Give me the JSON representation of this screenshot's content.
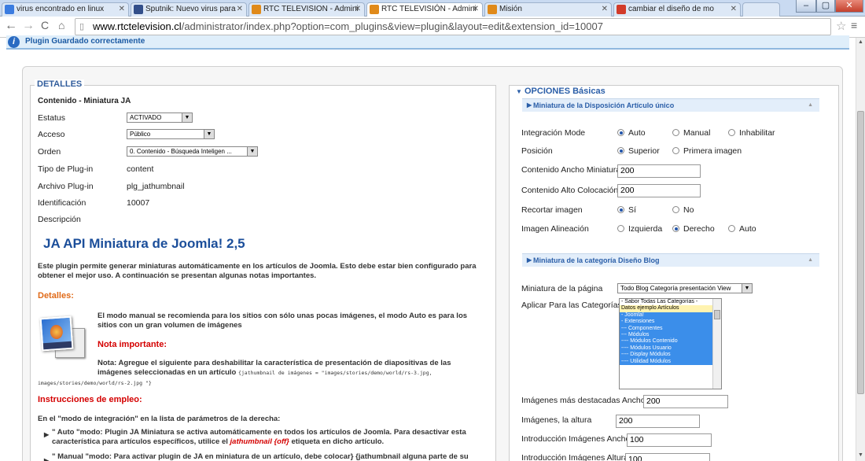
{
  "browser": {
    "tabs": [
      {
        "label": "virus encontrado en linux",
        "icon_color": "#3b7ce0"
      },
      {
        "label": "Sputnik: Nuevo virus para",
        "icon_color": "#334f8a"
      },
      {
        "label": "RTC TELEVISION - Admini",
        "icon_color": "#e08a1a"
      },
      {
        "label": "RTC TELEVISIÓN - Admini",
        "icon_color": "#e08a1a"
      },
      {
        "label": "Misión",
        "icon_color": "#e08a1a"
      },
      {
        "label": "cambiar el diseño de mo",
        "icon_color": "#d23b2a"
      }
    ],
    "url_host": "www.rtctelevision.cl",
    "url_path": "/administrator/index.php?option=com_plugins&view=plugin&layout=edit&extension_id=10007"
  },
  "message": "Plugin Guardado correctamente",
  "details": {
    "legend": "DETALLES",
    "plugin_title": "Contenido - Miniatura JA",
    "fields": {
      "estatus_label": "Estatus",
      "estatus_value": "ACTIVADO",
      "acceso_label": "Acceso",
      "acceso_value": "Público",
      "orden_label": "Orden",
      "orden_value": "0. Contenido - Búsqueda Inteligen ...",
      "tipo_label": "Tipo de Plug-in",
      "tipo_value": "content",
      "archivo_label": "Archivo Plug-in",
      "archivo_value": "plg_jathumbnail",
      "id_label": "Identificación",
      "id_value": "10007",
      "desc_label": "Descripción"
    },
    "description": {
      "title": "JA API Miniatura de Joomla! 2,5",
      "intro_1": "Este plugin permite generar miniaturas automáticamente en los artículos de Joomla. Esto debe estar bien configurado para",
      "intro_2": "obtener el mejor uso. A continuación se presentan algunas notas importantes.",
      "detalles_heading": "Detalles:",
      "detalles_1": "El modo manual se recomienda para los sitios con sólo unas pocas imágenes, el modo Auto es para los",
      "detalles_2": "sitios con un gran volumen de imágenes",
      "nota_heading": "Nota importante:",
      "nota_1": "Nota: Agregue el siguiente para deshabilitar la característica de presentación de diapositivas de las",
      "nota_2": "imágenes seleccionadas en un artículo",
      "nota_code_1": "{jathumbnail de imágenes = \"images/stories/demo/world/rs-3.jpg,",
      "nota_code_2": "images/stories/demo/world/rs-2.jpg \"}",
      "instr_heading": "Instrucciones de empleo:",
      "instr_intro": "En el \"modo de integración\" en la lista de parámetros de la derecha:",
      "bullet1_1": "\" Auto \"modo: Plugin JA Miniatura se activa automáticamente en todos los artículos de Joomla. Para desactivar esta",
      "bullet1_2": "característica para artículos específicos, utilice el",
      "bullet1_code": "jathumbnail {off}",
      "bullet1_3": "etiqueta en dicho artículo.",
      "bullet2_1": "\" Manual \"modo: Para activar plugin de JA en miniatura de un artículo, debe colocar} {jathumbnail alguna parte de su"
    }
  },
  "options": {
    "title": "OPCIONES Básicas",
    "section1": "Miniatura de la Disposición Artículo único",
    "integration_label": "Integración Mode",
    "integration_options": [
      "Auto",
      "Manual",
      "Inhabilitar"
    ],
    "posicion_label": "Posición",
    "posicion_options": [
      "Superior",
      "Primera imagen"
    ],
    "ancho_label": "Contenido Ancho Miniatura",
    "ancho_value": "200",
    "alto_label": "Contenido Alto Colocación",
    "alto_value": "200",
    "recortar_label": "Recortar imagen",
    "recortar_options": [
      "Sí",
      "No"
    ],
    "alineacion_label": "Imagen Alineación",
    "alineacion_options": [
      "Izquierda",
      "Derecho",
      "Auto"
    ],
    "section2": "Miniatura de la categoría Diseño Blog",
    "pagina_label": "Miniatura de la página",
    "pagina_value": "Todo Blog Categoría presentación View",
    "aplicar_label": "Aplicar Para las Categorías",
    "categories": [
      "- Sabor Todas Las Categorías -",
      "Datos ejemplo Artículos",
      "- Joomla!",
      "- Extensiones",
      "--- Componentes",
      "--- Módulos",
      "---- Módulos Contenido",
      "---- Módulos Usuario",
      "---- Display Módulos",
      "---- Utilidad Módulos"
    ],
    "destacadas_ancho_label": "Imágenes más destacadas Ancho",
    "destacadas_ancho_value": "200",
    "altura_label": "Imágenes, la altura",
    "altura_value": "200",
    "intro_ancho_label": "Introducción Imágenes Ancho",
    "intro_ancho_value": "100",
    "intro_altura_label": "Introducción Imágenes Altura",
    "intro_altura_value": "100"
  }
}
